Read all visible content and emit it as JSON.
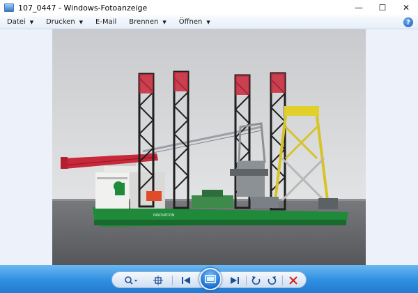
{
  "window": {
    "title": "107_0447 - Windows-Fotoanzeige",
    "minimize": "—",
    "maximize": "☐",
    "close": "✕"
  },
  "menu": {
    "items": [
      {
        "label": "Datei",
        "has_dropdown": true
      },
      {
        "label": "Drucken",
        "has_dropdown": true
      },
      {
        "label": "E-Mail",
        "has_dropdown": false
      },
      {
        "label": "Brennen",
        "has_dropdown": true
      },
      {
        "label": "Öffnen",
        "has_dropdown": true
      }
    ],
    "help": "?"
  },
  "toolbar": {
    "zoom_icon": "zoom-icon",
    "fit_icon": "actual-size-icon",
    "prev_icon": "previous-icon",
    "slideshow_icon": "slideshow-icon",
    "next_icon": "next-icon",
    "rotate_left_icon": "rotate-ccw-icon",
    "rotate_right_icon": "rotate-cw-icon",
    "delete_icon": "delete-icon"
  },
  "colors": {
    "toolbar_blue": "#2f8ee0",
    "delete_red": "#d42020",
    "viewer_bg": "#edf2fa"
  }
}
